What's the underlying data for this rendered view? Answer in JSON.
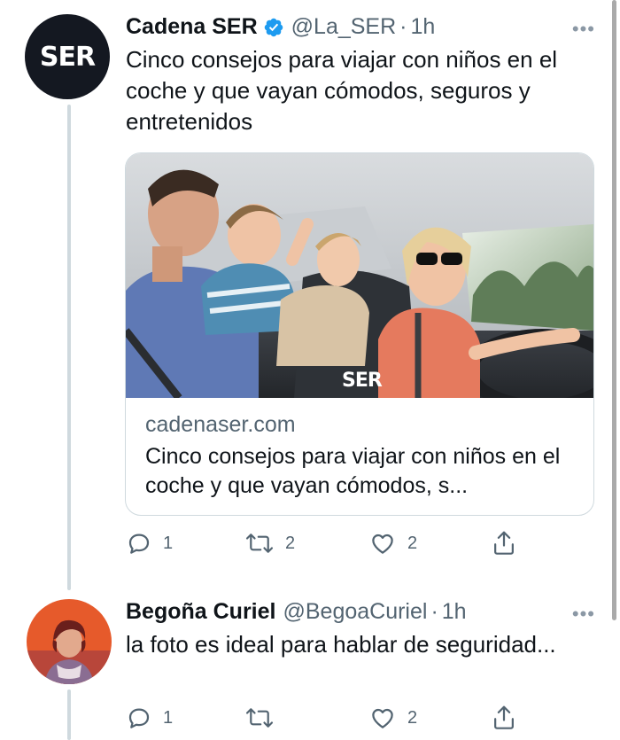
{
  "tweets": [
    {
      "name": "Cadena SER",
      "handle": "@La_SER",
      "separator": "·",
      "time": "1h",
      "more": "•••",
      "avatar_logo": "SER",
      "text": "Cinco consejos para viajar con niños en el coche y que vayan cómodos, seguros y entretenidos",
      "card": {
        "image_watermark": "SER",
        "domain": "cadenaser.com",
        "title": "Cinco consejos para viajar con niños en el coche y que vayan cómodos, s..."
      },
      "actions": {
        "reply_count": "1",
        "retweet_count": "2",
        "like_count": "2"
      }
    },
    {
      "name": "Begoña Curiel",
      "handle": "@BegoaCuriel",
      "separator": "·",
      "time": "1h",
      "more": "•••",
      "text": "la foto es ideal para hablar de seguridad...",
      "actions": {
        "reply_count": "1",
        "retweet_count": "",
        "like_count": "2"
      }
    }
  ],
  "icons": {
    "verified": "verified-badge-icon",
    "reply": "reply-icon",
    "retweet": "retweet-icon",
    "like": "heart-icon",
    "share": "share-icon"
  },
  "colors": {
    "verified": "#1d9bf0",
    "text": "#0f1419",
    "secondary": "#536471",
    "thread_line": "#cfd9de"
  }
}
